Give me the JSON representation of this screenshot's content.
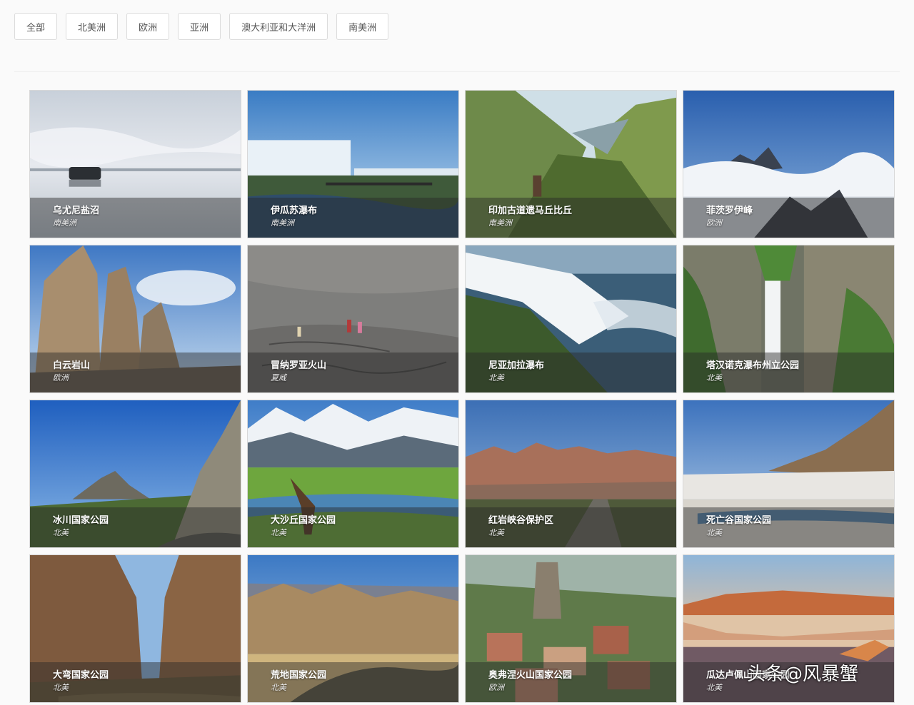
{
  "filters": [
    "全部",
    "北美洲",
    "欧洲",
    "亚洲",
    "澳大利亚和大洋洲",
    "南美洲"
  ],
  "cards": [
    {
      "name": "乌尤尼盐沼",
      "region": "南美洲"
    },
    {
      "name": "伊瓜苏瀑布",
      "region": "南美洲"
    },
    {
      "name": "印加古道遗马丘比丘",
      "region": "南美洲"
    },
    {
      "name": "菲茨罗伊峰",
      "region": "欧洲"
    },
    {
      "name": "白云岩山",
      "region": "欧洲"
    },
    {
      "name": "冒纳罗亚火山",
      "region": "夏威"
    },
    {
      "name": "尼亚加拉瀑布",
      "region": "北美"
    },
    {
      "name": "塔汉诺克瀑布州立公园",
      "region": "北美"
    },
    {
      "name": "冰川国家公园",
      "region": "北美"
    },
    {
      "name": "大沙丘国家公园",
      "region": "北美"
    },
    {
      "name": "红岩峡谷保护区",
      "region": "北美"
    },
    {
      "name": "死亡谷国家公园",
      "region": "北美"
    },
    {
      "name": "大弯国家公园",
      "region": "北美"
    },
    {
      "name": "荒地国家公园",
      "region": "北美"
    },
    {
      "name": "奥弗涅火山国家公园",
      "region": "欧洲"
    },
    {
      "name": "瓜达卢佩山国家公园",
      "region": "北美"
    }
  ],
  "watermark": "头条@风暴蟹"
}
